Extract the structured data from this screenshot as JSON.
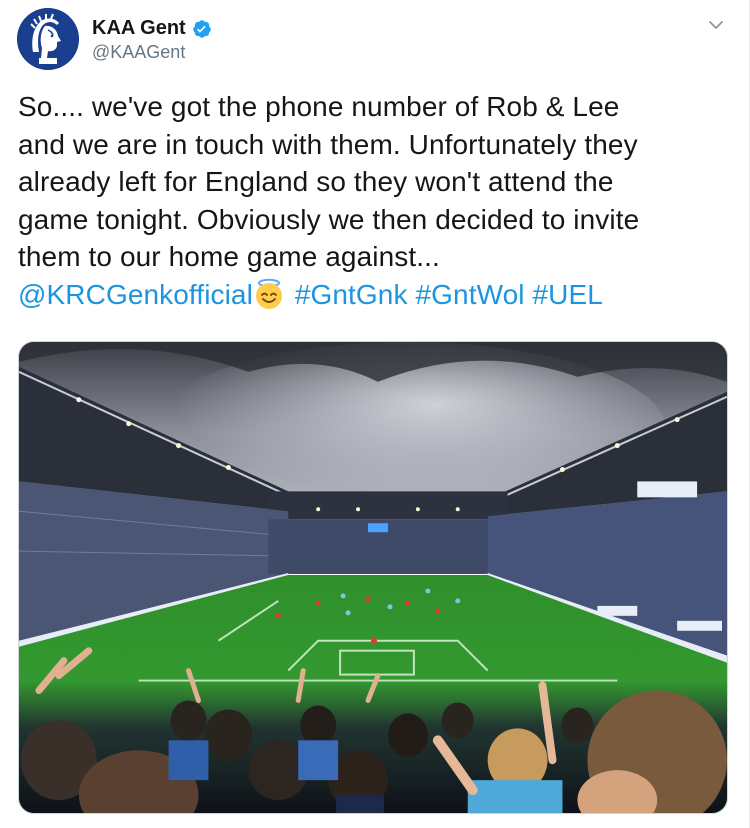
{
  "author": {
    "display_name": "KAA Gent",
    "handle": "@KAAGent",
    "verified": true,
    "avatar_icon": "kaa-gent-crest-icon"
  },
  "tweet": {
    "text_lines": [
      "So.... we've got the phone number of Rob & Lee",
      "and we are in touch with them. Unfortunately they",
      "already left for England so they won't attend the",
      "game tonight. Obviously we then decided to invite",
      "them to our home game against..."
    ],
    "mention": "@KRCGenkofficial",
    "emoji_icon": "smiling-face-with-halo-icon",
    "hashtags": [
      "#GntGnk",
      "#GntWol",
      "#UEL"
    ]
  },
  "media": {
    "description_icon": "stadium-photo"
  },
  "colors": {
    "link": "#1b95e0",
    "text": "#14171a",
    "muted": "#657786",
    "verified": "#1da1f2",
    "brand": "#1b3f8f"
  }
}
